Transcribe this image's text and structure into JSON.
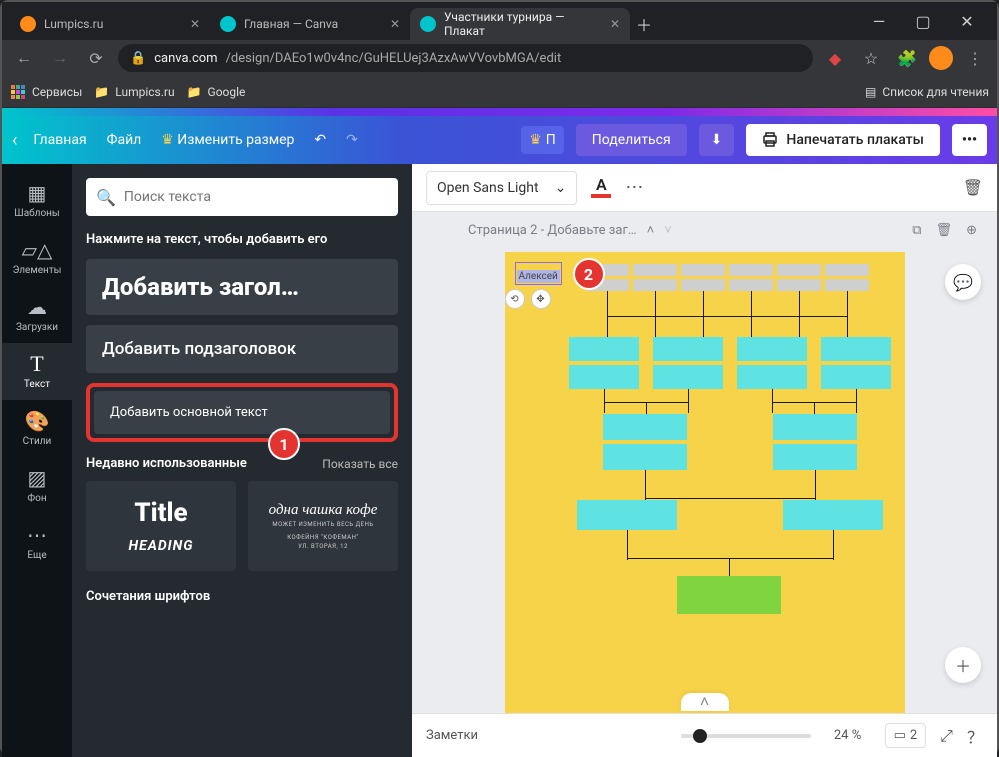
{
  "browser": {
    "tabs": [
      {
        "title": "Lumpics.ru",
        "favicon": "#ff8c1a"
      },
      {
        "title": "Главная — Canva",
        "favicon": "#00c4cc"
      },
      {
        "title": "Участники турнира — Плакат",
        "favicon": "#00c4cc"
      }
    ],
    "url_domain": "canva.com",
    "url_path": "/design/DAEo1w0v4nc/GuHELUej3AzxAwVVovbMGA/edit",
    "bookmarks": {
      "services": "Сервисы",
      "lumpics": "Lumpics.ru",
      "google": "Google",
      "reading_list": "Список для чтения"
    }
  },
  "topbar": {
    "home": "Главная",
    "file": "Файл",
    "resize": "Изменить размер",
    "premium_short": "П",
    "share": "Поделиться",
    "print": "Напечатать плакаты",
    "more": "•••"
  },
  "rail": {
    "templates": "Шаблоны",
    "elements": "Элементы",
    "uploads": "Загрузки",
    "text": "Текст",
    "styles": "Стили",
    "background": "Фон",
    "more": "Еще"
  },
  "panel": {
    "search_placeholder": "Поиск текста",
    "hint": "Нажмите на текст, чтобы добавить его",
    "add_heading": "Добавить загол…",
    "add_subheading": "Добавить подзаголовок",
    "add_body": "Добавить основной текст",
    "recent_title": "Недавно использованные",
    "show_all": "Показать все",
    "sample_title": "Title",
    "sample_heading": "HEADING",
    "sample_cursive": "одна чашка кофе",
    "sample_sub1": "МОЖЕТ ИЗМЕНИТЬ ВЕСЬ ДЕНЬ",
    "sample_sub2": "КОФЕЙНЯ \"КОФЕМАН\"",
    "sample_sub3": "УЛ. ВТОРАЯ, 12",
    "fonts_title": "Сочетания шрифтов"
  },
  "toolbar": {
    "font": "Open Sans Light"
  },
  "page": {
    "title": "Страница 2 - Добавьте заг…"
  },
  "canvas": {
    "text_value": "Алексей"
  },
  "footer": {
    "notes": "Заметки",
    "zoom": "24 %",
    "page_count": "2"
  },
  "badges": {
    "one": "1",
    "two": "2"
  }
}
